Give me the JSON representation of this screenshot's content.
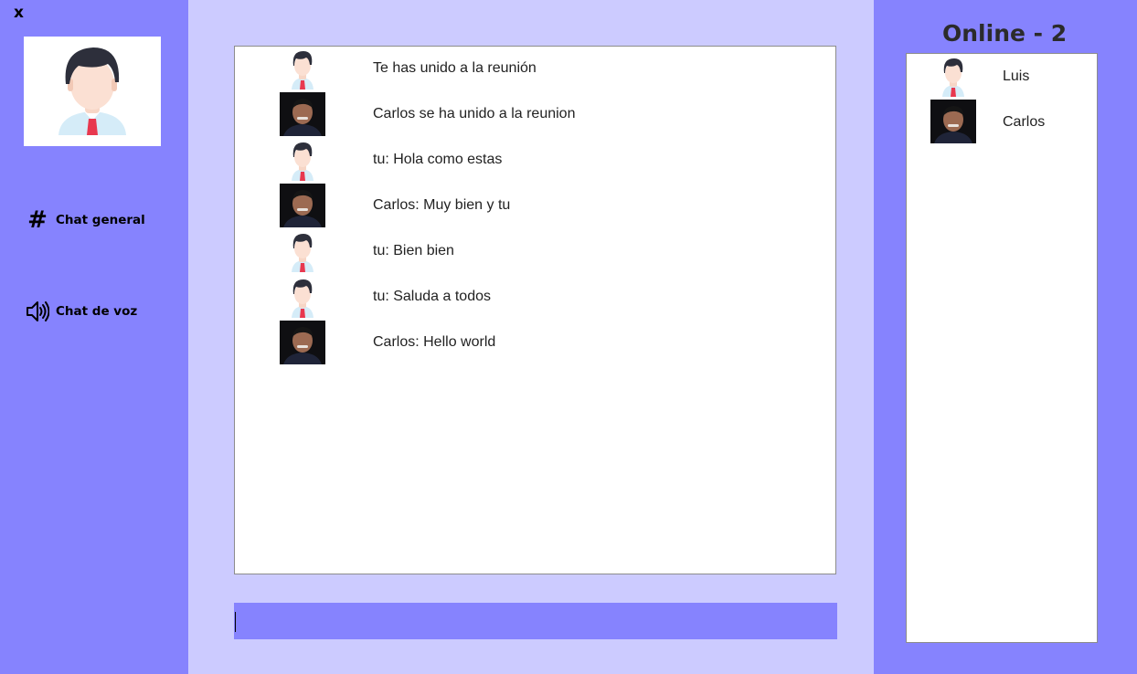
{
  "window": {
    "close_label": "x"
  },
  "sidebar": {
    "items": [
      {
        "label": "Chat general",
        "icon": "hash-icon"
      },
      {
        "label": "Chat de voz",
        "icon": "speaker-icon"
      }
    ]
  },
  "chat": {
    "messages": [
      {
        "avatar": "default-avatar",
        "text": "Te has unido a la reunión"
      },
      {
        "avatar": "photo-avatar",
        "text": "Carlos se ha unido a la reunion"
      },
      {
        "avatar": "default-avatar",
        "text": "tu:  Hola como estas"
      },
      {
        "avatar": "photo-avatar",
        "text": "Carlos: Muy bien y tu"
      },
      {
        "avatar": "default-avatar",
        "text": "tu:  Bien bien"
      },
      {
        "avatar": "default-avatar",
        "text": "tu:  Saluda a todos"
      },
      {
        "avatar": "photo-avatar",
        "text": "Carlos: Hello world"
      }
    ],
    "input_value": ""
  },
  "online": {
    "title": "Online - 2",
    "users": [
      {
        "name": "Luis",
        "avatar": "default-avatar"
      },
      {
        "name": "Carlos",
        "avatar": "photo-avatar"
      }
    ]
  },
  "colors": {
    "side_panels": "#8683fe",
    "center_bg": "#cccbff",
    "box_bg": "#ffffff"
  }
}
